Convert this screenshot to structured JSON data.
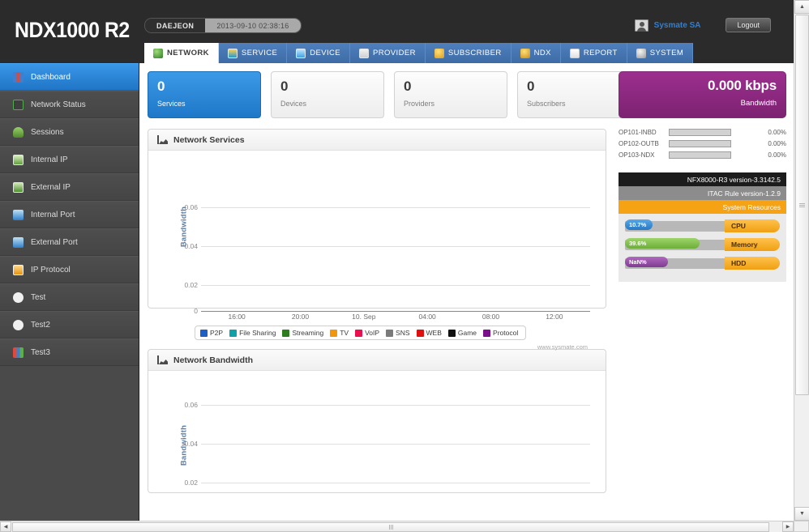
{
  "header": {
    "logo": "NDX1000 R2",
    "site": "DAEJEON",
    "datetime": "2013-09-10 02:38:16",
    "username": "Sysmate SA",
    "logout_label": "Logout",
    "tabs": [
      {
        "label": "NETWORK",
        "icon": "globe-icon",
        "active": true
      },
      {
        "label": "SERVICE",
        "icon": "service-icon",
        "active": false
      },
      {
        "label": "DEVICE",
        "icon": "device-icon",
        "active": false
      },
      {
        "label": "PROVIDER",
        "icon": "provider-icon",
        "active": false
      },
      {
        "label": "SUBSCRIBER",
        "icon": "subscriber-icon",
        "active": false
      },
      {
        "label": "NDX",
        "icon": "ndx-icon",
        "active": false
      },
      {
        "label": "REPORT",
        "icon": "report-icon",
        "active": false
      },
      {
        "label": "SYSTEM",
        "icon": "gear-icon",
        "active": false
      }
    ]
  },
  "sidebar": {
    "items": [
      {
        "label": "Dashboard",
        "icon": "bar-chart-icon",
        "active": true
      },
      {
        "label": "Network Status",
        "icon": "network-icon",
        "active": false
      },
      {
        "label": "Sessions",
        "icon": "sessions-icon",
        "active": false
      },
      {
        "label": "Internal IP",
        "icon": "internal-ip-icon",
        "active": false
      },
      {
        "label": "External IP",
        "icon": "external-ip-icon",
        "active": false
      },
      {
        "label": "Internal Port",
        "icon": "internal-port-icon",
        "active": false
      },
      {
        "label": "External Port",
        "icon": "external-port-icon",
        "active": false
      },
      {
        "label": "IP Protocol",
        "icon": "ip-protocol-icon",
        "active": false
      },
      {
        "label": "Test",
        "icon": "pie-chart-icon",
        "active": false
      },
      {
        "label": "Test2",
        "icon": "pie-chart-icon",
        "active": false
      },
      {
        "label": "Test3",
        "icon": "bar-chart-icon",
        "active": false
      }
    ]
  },
  "cards": [
    {
      "value": "0",
      "label": "Services",
      "highlight": true
    },
    {
      "value": "0",
      "label": "Devices",
      "highlight": false
    },
    {
      "value": "0",
      "label": "Providers",
      "highlight": false
    },
    {
      "value": "0",
      "label": "Subscribers",
      "highlight": false
    }
  ],
  "bandwidth_box": {
    "value": "0.000 kbps",
    "label": "Bandwidth",
    "color": "#8c2a80"
  },
  "interfaces": [
    {
      "name": "OP101-INBD",
      "percent": "0.00%",
      "fill": 0
    },
    {
      "name": "OP102-OUTB",
      "percent": "0.00%",
      "fill": 0
    },
    {
      "name": "OP103-NDX",
      "percent": "0.00%",
      "fill": 0
    }
  ],
  "system": {
    "firmware": "NFX8000-R3 version-3.3142.5",
    "rule": "ITAC Rule version-1.2.9",
    "resources_title": "System Resources",
    "resources": [
      {
        "label": "CPU",
        "value": "10.7%",
        "fill": 18,
        "color": "#2878c4"
      },
      {
        "label": "Memory",
        "value": "39.6%",
        "fill": 48,
        "color": "#6cae38"
      },
      {
        "label": "HDD",
        "value": "NaN%",
        "fill": 28,
        "color": "#7e3b90"
      }
    ]
  },
  "panels": [
    {
      "title": "Network Services",
      "icon": "chart-icon",
      "watermark": "www.sysmate.com"
    },
    {
      "title": "Network Bandwidth",
      "icon": "chart-icon",
      "watermark": ""
    }
  ],
  "chart_data": [
    {
      "type": "area",
      "title": "Network Services",
      "xlabel": "",
      "ylabel": "Bandwidth",
      "yticks": [
        "0",
        "0.02",
        "0.04",
        "0.06"
      ],
      "ylim": [
        0,
        0.07
      ],
      "grid": true,
      "legend_position": "bottom",
      "x": [
        "16:00",
        "20:00",
        "10. Sep",
        "04:00",
        "08:00",
        "12:00"
      ],
      "series": [
        {
          "name": "P2P",
          "color": "#1f5fc4",
          "values": [
            0,
            0,
            0,
            0,
            0,
            0
          ]
        },
        {
          "name": "File Sharing",
          "color": "#10a0a8",
          "values": [
            0,
            0,
            0,
            0,
            0,
            0
          ]
        },
        {
          "name": "Streaming",
          "color": "#2e7d1e",
          "values": [
            0,
            0,
            0,
            0,
            0,
            0
          ]
        },
        {
          "name": "TV",
          "color": "#f2960c",
          "values": [
            0,
            0,
            0,
            0,
            0,
            0
          ]
        },
        {
          "name": "VoIP",
          "color": "#e8104f",
          "values": [
            0,
            0,
            0,
            0,
            0,
            0
          ]
        },
        {
          "name": "SNS",
          "color": "#7a7a7a",
          "values": [
            0,
            0,
            0,
            0,
            0,
            0
          ]
        },
        {
          "name": "WEB",
          "color": "#e01010",
          "values": [
            0,
            0,
            0,
            0,
            0,
            0
          ]
        },
        {
          "name": "Game",
          "color": "#111111",
          "values": [
            0,
            0,
            0,
            0,
            0,
            0
          ]
        },
        {
          "name": "Protocol",
          "color": "#7a0f8c",
          "values": [
            0,
            0,
            0,
            0,
            0,
            0
          ]
        }
      ]
    },
    {
      "type": "area",
      "title": "Network Bandwidth",
      "xlabel": "",
      "ylabel": "Bandwidth",
      "yticks": [
        "0.02",
        "0.04",
        "0.06"
      ],
      "ylim": [
        0,
        0.07
      ],
      "grid": true,
      "legend_position": "bottom",
      "x": [],
      "series": []
    }
  ]
}
